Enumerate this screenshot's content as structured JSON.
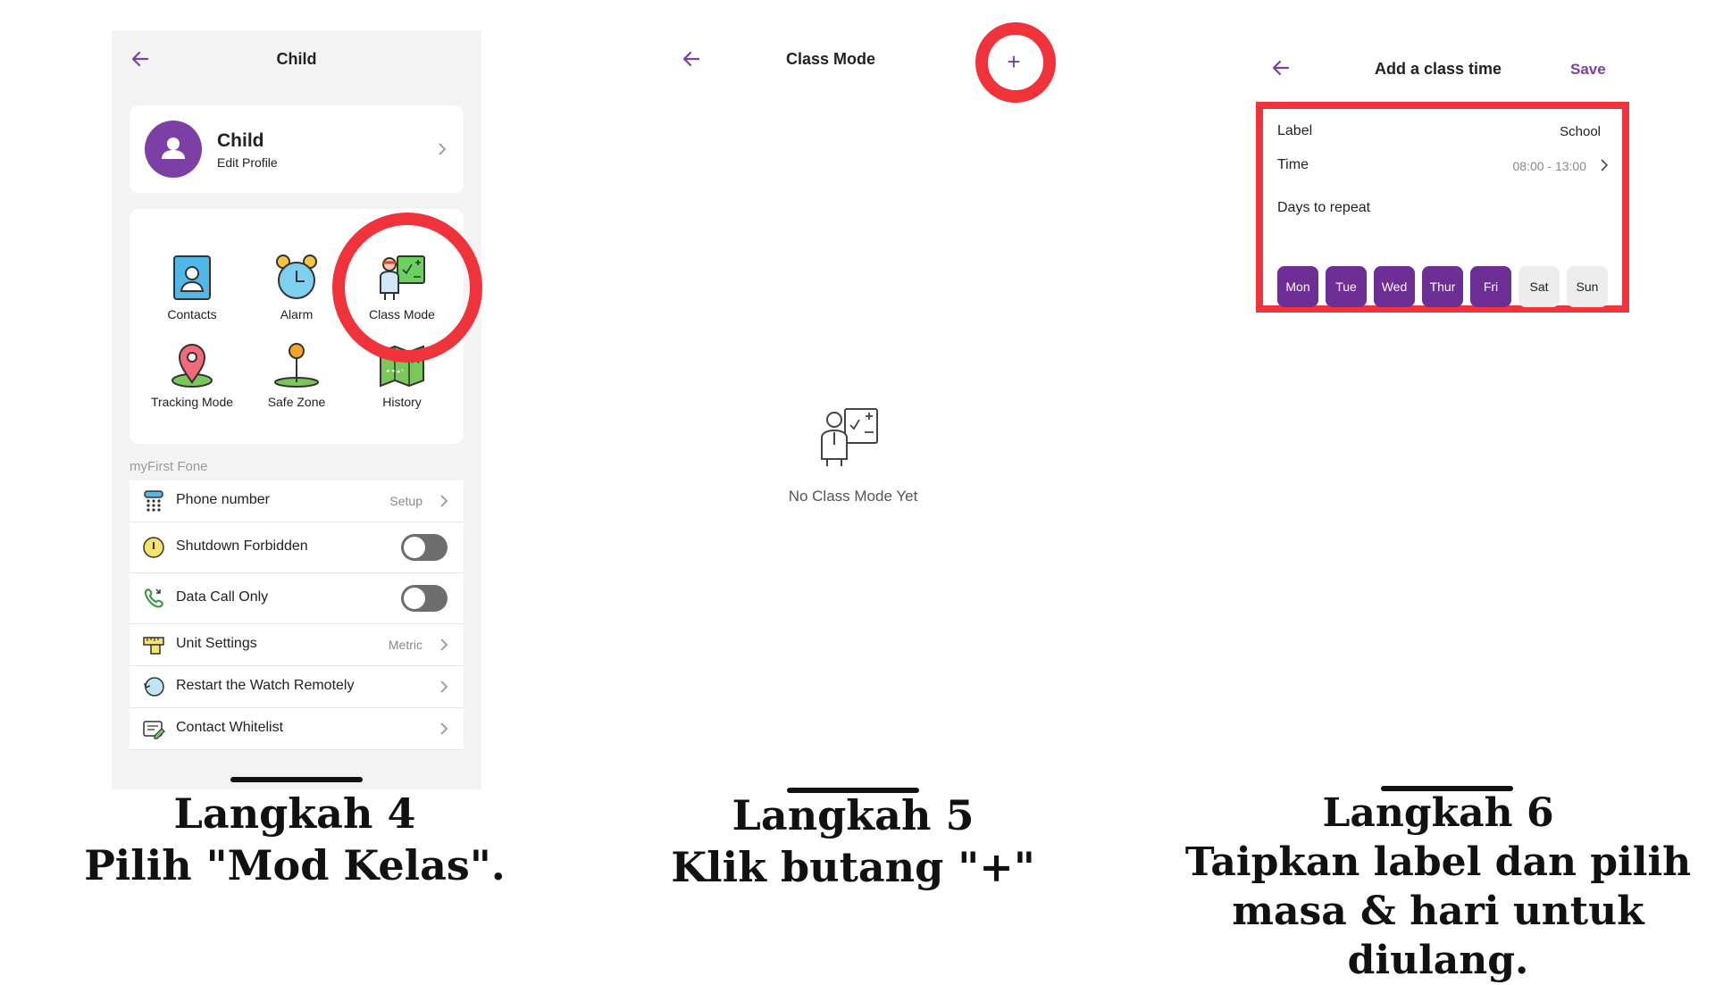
{
  "step4": {
    "nav_title": "Child",
    "profile": {
      "name": "Child",
      "subtitle": "Edit Profile"
    },
    "tiles": [
      {
        "label": "Contacts",
        "icon": "contacts-icon"
      },
      {
        "label": "Alarm",
        "icon": "alarm-clock-icon"
      },
      {
        "label": "Class Mode",
        "icon": "class-mode-icon"
      },
      {
        "label": "Tracking Mode",
        "icon": "location-pin-icon"
      },
      {
        "label": "Safe Zone",
        "icon": "safe-zone-pin-icon"
      },
      {
        "label": "History",
        "icon": "map-history-icon"
      }
    ],
    "section_header": "myFirst Fone",
    "list": [
      {
        "label": "Phone number",
        "value": "Setup",
        "icon": "dialpad-phone-icon"
      },
      {
        "label": "Shutdown Forbidden",
        "icon": "power-warning-icon",
        "toggle": "off"
      },
      {
        "label": "Data Call Only",
        "icon": "phone-call-icon",
        "toggle": "off"
      },
      {
        "label": "Unit Settings",
        "value": "Metric",
        "icon": "ruler-icon"
      },
      {
        "label": "Restart the Watch Remotely",
        "icon": "restart-icon"
      },
      {
        "label": "Contact Whitelist",
        "icon": "whitelist-icon"
      }
    ],
    "caption_line1": "Langkah 4",
    "caption_line2": "Pilih \"Mod Kelas\"."
  },
  "step5": {
    "nav_title": "Class Mode",
    "add_button": "+",
    "empty_text": "No Class Mode Yet",
    "caption_line1": "Langkah 5",
    "caption_line2": "Klik butang \"+\""
  },
  "step6": {
    "nav_title": "Add a class time",
    "save_label": "Save",
    "label_field": {
      "label": "Label",
      "value": "School"
    },
    "time_field": {
      "label": "Time",
      "value": "08:00 - 13:00"
    },
    "days_header": "Days to repeat",
    "days": [
      {
        "label": "Mon",
        "selected": true
      },
      {
        "label": "Tue",
        "selected": true
      },
      {
        "label": "Wed",
        "selected": true
      },
      {
        "label": "Thur",
        "selected": true
      },
      {
        "label": "Fri",
        "selected": true
      },
      {
        "label": "Sat",
        "selected": false
      },
      {
        "label": "Sun",
        "selected": false
      }
    ],
    "caption_line1": "Langkah 6",
    "caption_line2": "Taipkan label dan pilih",
    "caption_line3": "masa & hari untuk diulang."
  },
  "colors": {
    "accent": "#6d2e95",
    "highlight": "#f0323a"
  }
}
